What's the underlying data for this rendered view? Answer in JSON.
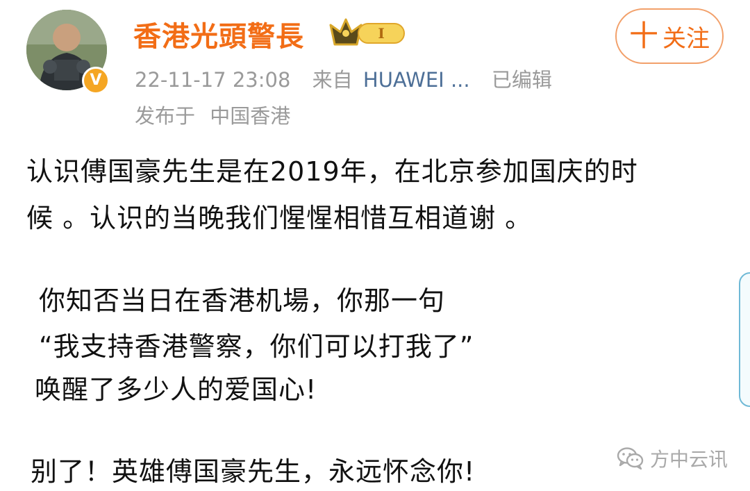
{
  "author": {
    "username": "香港光頭警長",
    "vip_level": "I",
    "verified_mark": "V"
  },
  "follow_button": {
    "plus": "十",
    "label": "关注"
  },
  "meta": {
    "time": "22-11-17 23:08",
    "from_label": "来自",
    "device": "HUAWEI ...",
    "edited": "已编辑",
    "location_prefix": "发布于",
    "location": "中国香港"
  },
  "post": {
    "line1": "认识傅国豪先生是在2019年，在北京参加国庆的时",
    "line2": "候 。认识的当晚我们惺惺相惜互相道谢 。",
    "line3": "你知否当日在香港机場，你那一句",
    "line4": "“我支持香港警察，你们可以打我了”",
    "line5": "唤醒了多少人的爱国心!",
    "line6": "别了！英雄傅国豪先生，永远怀念你!"
  },
  "watermark": {
    "text": "方中云讯",
    "icon": "wechat-icon"
  },
  "colors": {
    "username": "#f26d16",
    "device_link": "#4d6f97",
    "meta_gray": "#9a9a9a",
    "verified": "#f5a623"
  }
}
